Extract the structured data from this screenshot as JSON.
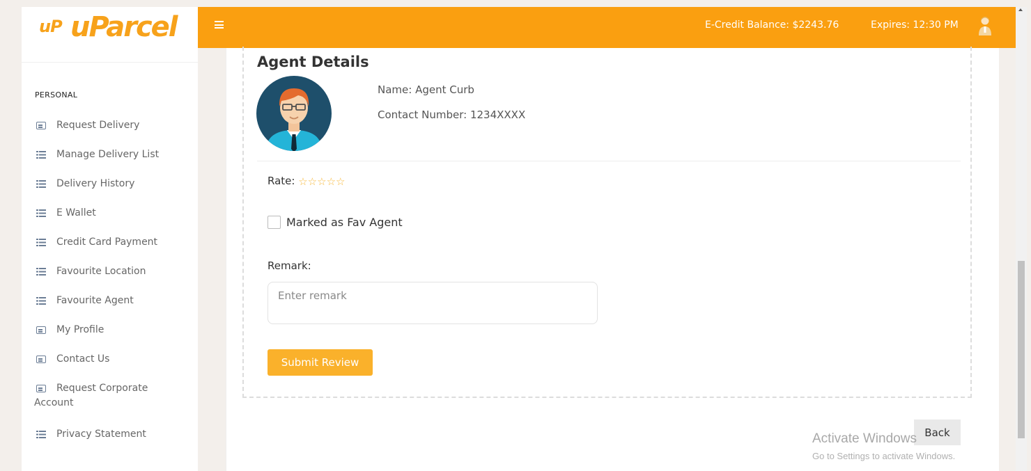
{
  "logo": {
    "small": "uP",
    "big": "uParcel"
  },
  "sidebar": {
    "section_label": "PERSONAL",
    "items": [
      {
        "label": "Request Delivery",
        "icon": "card-icon"
      },
      {
        "label": "Manage Delivery List",
        "icon": "list-icon"
      },
      {
        "label": "Delivery History",
        "icon": "list-icon"
      },
      {
        "label": "E Wallet",
        "icon": "list-icon"
      },
      {
        "label": "Credit Card Payment",
        "icon": "list-icon"
      },
      {
        "label": "Favourite Location",
        "icon": "list-icon"
      },
      {
        "label": "Favourite Agent",
        "icon": "list-icon"
      },
      {
        "label": "My Profile",
        "icon": "card-icon"
      },
      {
        "label": "Contact Us",
        "icon": "card-icon"
      },
      {
        "label": "Request Corporate",
        "label2": "Account",
        "icon": "card-icon"
      },
      {
        "label": "Privacy Statement",
        "icon": "list-icon"
      }
    ]
  },
  "header": {
    "credit_balance": "E-Credit Balance: $2243.76",
    "expires": "Expires: 12:30 PM",
    "accent_color": "#fa9f10"
  },
  "agent": {
    "title": "Agent Details",
    "name": "Name: Agent Curb",
    "contact": "Contact Number: 1234XXXX"
  },
  "review": {
    "rate_label": "Rate:",
    "stars": "☆☆☆☆☆",
    "rating_value": 0,
    "rating_max": 5,
    "fav_label": "Marked as Fav Agent",
    "fav_checked": false,
    "remark_label": "Remark:",
    "remark_placeholder": "Enter remark",
    "remark_value": "",
    "submit_label": "Submit Review"
  },
  "back_label": "Back",
  "watermark": {
    "line1": "Activate Windows",
    "line2": "Go to Settings to activate Windows."
  }
}
